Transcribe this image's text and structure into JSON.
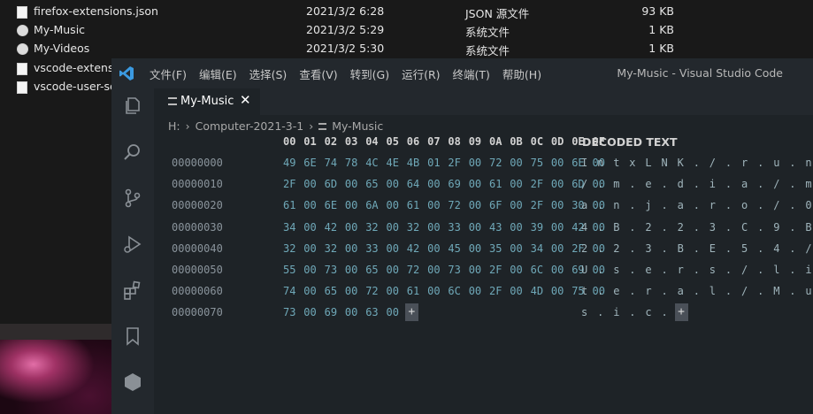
{
  "explorer": {
    "files": [
      {
        "name": "firefox-extensions.json",
        "date": "2021/3/2 6:28",
        "type": "JSON 源文件",
        "size": "93 KB",
        "icon": "file-icon"
      },
      {
        "name": "My-Music",
        "date": "2021/3/2 5:29",
        "type": "系统文件",
        "size": "1 KB",
        "icon": "system-file-icon"
      },
      {
        "name": "My-Videos",
        "date": "2021/3/2 5:30",
        "type": "系统文件",
        "size": "1 KB",
        "icon": "system-file-icon"
      },
      {
        "name": "vscode-extensio",
        "date": "",
        "type": "",
        "size": "",
        "icon": "file-icon"
      },
      {
        "name": "vscode-user-se",
        "date": "",
        "type": "",
        "size": "",
        "icon": "file-icon"
      }
    ]
  },
  "vscode": {
    "menu": [
      "文件(F)",
      "编辑(E)",
      "选择(S)",
      "查看(V)",
      "转到(G)",
      "运行(R)",
      "终端(T)",
      "帮助(H)"
    ],
    "window_title": "My-Music - Visual Studio Code",
    "activity_icons": [
      "files-icon",
      "search-icon",
      "source-control-icon",
      "run-debug-icon",
      "extensions-icon",
      "bookmark-icon",
      "hexagon-icon"
    ],
    "tab": {
      "label": "My-Music",
      "close": "✕"
    },
    "breadcrumb": {
      "folder": "H:",
      "path": "Computer-2021-3-1",
      "file": "My-Music"
    },
    "hex_editor": {
      "columns": [
        "00",
        "01",
        "02",
        "03",
        "04",
        "05",
        "06",
        "07",
        "08",
        "09",
        "0A",
        "0B",
        "0C",
        "0D",
        "0E",
        "0F"
      ],
      "decoded_header": "DECODED TEXT",
      "add_symbol": "+",
      "rows": [
        {
          "addr": "00000000",
          "bytes": [
            "49",
            "6E",
            "74",
            "78",
            "4C",
            "4E",
            "4B",
            "01",
            "2F",
            "00",
            "72",
            "00",
            "75",
            "00",
            "6E",
            "00"
          ],
          "decoded": [
            "I",
            "n",
            "t",
            "x",
            "L",
            "N",
            "K",
            ".",
            "/",
            ".",
            "r",
            ".",
            "u",
            ".",
            "n",
            "."
          ]
        },
        {
          "addr": "00000010",
          "bytes": [
            "2F",
            "00",
            "6D",
            "00",
            "65",
            "00",
            "64",
            "00",
            "69",
            "00",
            "61",
            "00",
            "2F",
            "00",
            "6D",
            "00"
          ],
          "decoded": [
            "/",
            ".",
            "m",
            ".",
            "e",
            ".",
            "d",
            ".",
            "i",
            ".",
            "a",
            ".",
            "/",
            ".",
            "m",
            "."
          ]
        },
        {
          "addr": "00000020",
          "bytes": [
            "61",
            "00",
            "6E",
            "00",
            "6A",
            "00",
            "61",
            "00",
            "72",
            "00",
            "6F",
            "00",
            "2F",
            "00",
            "30",
            "00"
          ],
          "decoded": [
            "a",
            ".",
            "n",
            ".",
            "j",
            ".",
            "a",
            ".",
            "r",
            ".",
            "o",
            ".",
            "/",
            ".",
            "0",
            "."
          ]
        },
        {
          "addr": "00000030",
          "bytes": [
            "34",
            "00",
            "42",
            "00",
            "32",
            "00",
            "32",
            "00",
            "33",
            "00",
            "43",
            "00",
            "39",
            "00",
            "42",
            "00"
          ],
          "decoded": [
            "4",
            ".",
            "B",
            ".",
            "2",
            ".",
            "2",
            ".",
            "3",
            ".",
            "C",
            ".",
            "9",
            ".",
            "B",
            "."
          ]
        },
        {
          "addr": "00000040",
          "bytes": [
            "32",
            "00",
            "32",
            "00",
            "33",
            "00",
            "42",
            "00",
            "45",
            "00",
            "35",
            "00",
            "34",
            "00",
            "2F",
            "00"
          ],
          "decoded": [
            "2",
            ".",
            "2",
            ".",
            "3",
            ".",
            "B",
            ".",
            "E",
            ".",
            "5",
            ".",
            "4",
            ".",
            "/",
            "."
          ]
        },
        {
          "addr": "00000050",
          "bytes": [
            "55",
            "00",
            "73",
            "00",
            "65",
            "00",
            "72",
            "00",
            "73",
            "00",
            "2F",
            "00",
            "6C",
            "00",
            "69",
            "00"
          ],
          "decoded": [
            "U",
            ".",
            "s",
            ".",
            "e",
            ".",
            "r",
            ".",
            "s",
            ".",
            "/",
            ".",
            "l",
            ".",
            "i",
            "."
          ]
        },
        {
          "addr": "00000060",
          "bytes": [
            "74",
            "00",
            "65",
            "00",
            "72",
            "00",
            "61",
            "00",
            "6C",
            "00",
            "2F",
            "00",
            "4D",
            "00",
            "75",
            "00"
          ],
          "decoded": [
            "t",
            ".",
            "e",
            ".",
            "r",
            ".",
            "a",
            ".",
            "l",
            ".",
            "/",
            ".",
            "M",
            ".",
            "u",
            "."
          ]
        },
        {
          "addr": "00000070",
          "bytes": [
            "73",
            "00",
            "69",
            "00",
            "63",
            "00"
          ],
          "decoded": [
            "s",
            ".",
            "i",
            ".",
            "c",
            "."
          ]
        }
      ]
    }
  }
}
